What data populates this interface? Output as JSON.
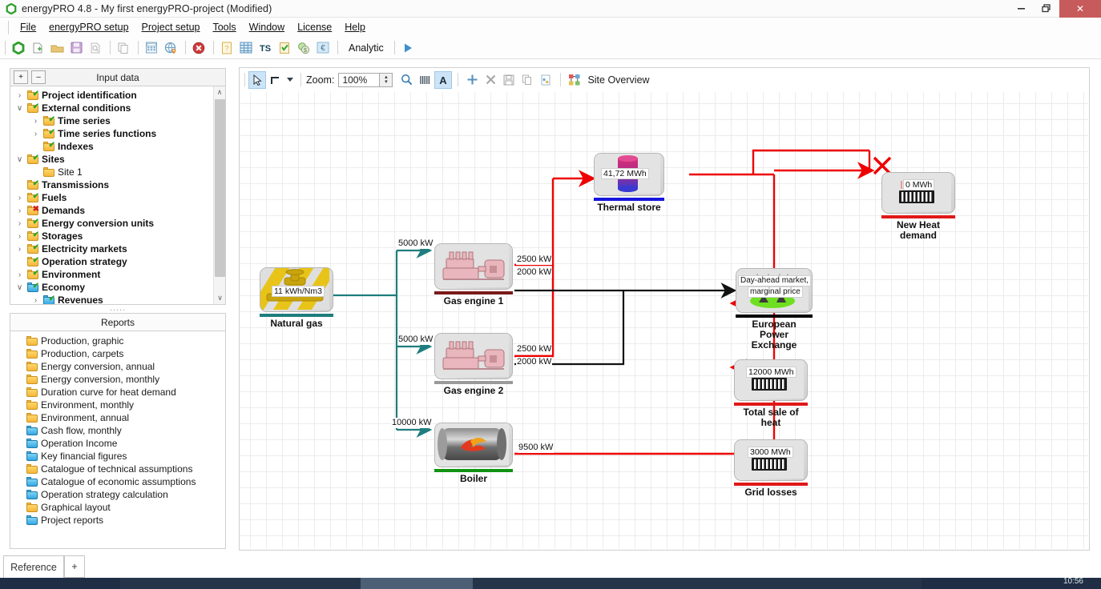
{
  "window": {
    "title": "energyPRO 4.8  -  My first energyPRO-project (Modified)",
    "minimize": "–",
    "restore": "❐",
    "close": "✕"
  },
  "menu": [
    {
      "label": "File"
    },
    {
      "label": "energyPRO setup"
    },
    {
      "label": "Project setup"
    },
    {
      "label": "Tools"
    },
    {
      "label": "Window"
    },
    {
      "label": "License"
    },
    {
      "label": "Help"
    }
  ],
  "toolbar": {
    "icons": [
      "energypro-logo-icon",
      "new-project-icon",
      "open-folder-icon",
      "save-icon",
      "print-preview-icon",
      "copy-icon",
      "calculator-icon",
      "globe-location-icon",
      "stop-icon",
      "report-icon",
      "table-icon",
      "time-series-icon",
      "clipboard-green-icon",
      "currency-coins-icon",
      "euro-icon"
    ],
    "analytic_label": "Analytic",
    "run_label": "▶"
  },
  "input_panel": {
    "title": "Input data",
    "expand_all": "+",
    "collapse_all": "–",
    "scroll_up": "∧",
    "scroll_down": "∨",
    "items": [
      {
        "label": "Project identification",
        "indent": 0,
        "expander": "›",
        "folder": "yellow",
        "overlay": "check",
        "bold": true
      },
      {
        "label": "External conditions",
        "indent": 0,
        "expander": "∨",
        "folder": "yellow",
        "overlay": "check",
        "bold": true
      },
      {
        "label": "Time series",
        "indent": 1,
        "expander": "›",
        "folder": "yellow",
        "overlay": "check",
        "bold": true
      },
      {
        "label": "Time series functions",
        "indent": 1,
        "expander": "›",
        "folder": "yellow",
        "overlay": "check",
        "bold": true
      },
      {
        "label": "Indexes",
        "indent": 1,
        "expander": "",
        "folder": "yellow",
        "overlay": "check",
        "bold": true
      },
      {
        "label": "Sites",
        "indent": 0,
        "expander": "∨",
        "folder": "yellow",
        "overlay": "check",
        "bold": true
      },
      {
        "label": "Site 1",
        "indent": 1,
        "expander": "",
        "folder": "yellow",
        "overlay": "none",
        "bold": false
      },
      {
        "label": "Transmissions",
        "indent": 0,
        "expander": "",
        "folder": "yellow",
        "overlay": "check",
        "bold": true
      },
      {
        "label": "Fuels",
        "indent": 0,
        "expander": "›",
        "folder": "yellow",
        "overlay": "check",
        "bold": true
      },
      {
        "label": "Demands",
        "indent": 0,
        "expander": "›",
        "folder": "yellow",
        "overlay": "cross",
        "bold": true
      },
      {
        "label": "Energy conversion units",
        "indent": 0,
        "expander": "›",
        "folder": "yellow",
        "overlay": "check",
        "bold": true
      },
      {
        "label": "Storages",
        "indent": 0,
        "expander": "›",
        "folder": "yellow",
        "overlay": "check",
        "bold": true
      },
      {
        "label": "Electricity markets",
        "indent": 0,
        "expander": "›",
        "folder": "yellow",
        "overlay": "check",
        "bold": true
      },
      {
        "label": "Operation strategy",
        "indent": 0,
        "expander": "",
        "folder": "yellow",
        "overlay": "check",
        "bold": true
      },
      {
        "label": "Environment",
        "indent": 0,
        "expander": "›",
        "folder": "yellow",
        "overlay": "check",
        "bold": true
      },
      {
        "label": "Economy",
        "indent": 0,
        "expander": "∨",
        "folder": "blue",
        "overlay": "check",
        "bold": true
      },
      {
        "label": "Revenues",
        "indent": 1,
        "expander": "›",
        "folder": "blue",
        "overlay": "check",
        "bold": true
      }
    ]
  },
  "splitter_dots": ".....",
  "reports_panel": {
    "title": "Reports",
    "items": [
      {
        "label": "Production, graphic",
        "folder": "yellow"
      },
      {
        "label": "Production, carpets",
        "folder": "yellow"
      },
      {
        "label": "Energy conversion, annual",
        "folder": "yellow"
      },
      {
        "label": "Energy conversion, monthly",
        "folder": "yellow"
      },
      {
        "label": "Duration curve for heat demand",
        "folder": "yellow"
      },
      {
        "label": "Environment, monthly",
        "folder": "yellow"
      },
      {
        "label": "Environment, annual",
        "folder": "yellow"
      },
      {
        "label": "Cash flow, monthly",
        "folder": "blue"
      },
      {
        "label": "Operation Income",
        "folder": "blue"
      },
      {
        "label": "Key financial figures",
        "folder": "blue"
      },
      {
        "label": "Catalogue of technical assumptions",
        "folder": "yellow"
      },
      {
        "label": "Catalogue of economic assumptions",
        "folder": "blue"
      },
      {
        "label": "Operation strategy calculation",
        "folder": "blue"
      },
      {
        "label": "Graphical layout",
        "folder": "yellow"
      },
      {
        "label": "Project reports",
        "folder": "blue"
      }
    ]
  },
  "diagram_toolbar": {
    "pointer_icon": "pointer-arrow-icon",
    "line_icon": "step-line-icon",
    "dropdown_icon": "chevron-down-icon",
    "zoom_label": "Zoom:",
    "zoom_value": "100%",
    "spin_up": "▴",
    "spin_down": "▾",
    "magnifier_icon": "magnifier-icon",
    "grid_icon": "grid-lines-icon",
    "text_icon": "text-tool-icon",
    "add_icon": "plus-icon",
    "delete_icon": "delete-x-icon",
    "save_icon": "save-floppy-icon",
    "copy_icon": "copy-icon",
    "export_icon": "export-image-icon",
    "site_overview_icon": "site-overview-icon",
    "site_overview_label": "Site Overview"
  },
  "diagram": {
    "nodes": [
      {
        "id": "natural_gas",
        "label": "Natural gas",
        "badge": "11 kWh/Nm3",
        "bar_color": "#1f7d7d"
      },
      {
        "id": "gas_engine_1",
        "label": "Gas engine 1",
        "badge": "",
        "bar_color": "#7b1a1a"
      },
      {
        "id": "gas_engine_2",
        "label": "Gas engine 2",
        "badge": "",
        "bar_color": "#9a9a9a"
      },
      {
        "id": "boiler",
        "label": "Boiler",
        "badge": "",
        "bar_color": "#119211"
      },
      {
        "id": "thermal_store",
        "label": "Thermal store",
        "badge": "41,72 MWh",
        "bar_color": "#1616dd"
      },
      {
        "id": "new_heat_demand",
        "label": "New Heat\ndemand",
        "badge": "0 MWh",
        "bar_color": "#e01818"
      },
      {
        "id": "power_exchange",
        "label": "European\nPower Exchange",
        "badge": "Day-ahead market,\nmarginal price",
        "bar_color": "#000000"
      },
      {
        "id": "total_sale_heat",
        "label": "Total sale of\nheat",
        "badge": "12000 MWh",
        "bar_color": "#e01818"
      },
      {
        "id": "grid_losses",
        "label": "Grid losses",
        "badge": "3000 MWh",
        "bar_color": "#e01818"
      }
    ],
    "node_labels": {
      "natural_gas": "Natural gas",
      "gas_engine_1": "Gas engine 1",
      "gas_engine_2": "Gas engine 2",
      "boiler": "Boiler",
      "thermal_store": "Thermal store",
      "new_heat_demand_l1": "New Heat",
      "new_heat_demand_l2": "demand",
      "power_exchange_l1": "European",
      "power_exchange_l2": "Power Exchange",
      "total_sale_heat_l1": "Total sale of",
      "total_sale_heat_l2": "heat",
      "grid_losses": "Grid losses"
    },
    "badges": {
      "natural_gas": "11 kWh/Nm3",
      "thermal_store": "41,72 MWh",
      "new_heat_demand": "0 MWh",
      "power_exchange_l1": "Day-ahead market,",
      "power_exchange_l2": "marginal price",
      "total_sale_heat": "12000 MWh",
      "grid_losses": "3000 MWh"
    },
    "flow_labels": {
      "gas_to_engine1": "5000 kW",
      "gas_to_engine2": "5000 kW",
      "gas_to_boiler": "10000 kW",
      "engine1_heat": "2500 kW",
      "engine1_power": "2000 kW",
      "engine2_heat": "2500 kW",
      "engine2_power": "2000 kW",
      "boiler_heat": "9500 kW"
    },
    "colors": {
      "fuel_line": "#1f7d7d",
      "heat_line": "#ee0000",
      "power_line": "#000000",
      "disabled_marker": "#ee0000"
    }
  },
  "tabs": {
    "items": [
      {
        "label": "Reference"
      },
      {
        "label": "+"
      }
    ]
  },
  "taskbar": {
    "clock": "10:56"
  }
}
